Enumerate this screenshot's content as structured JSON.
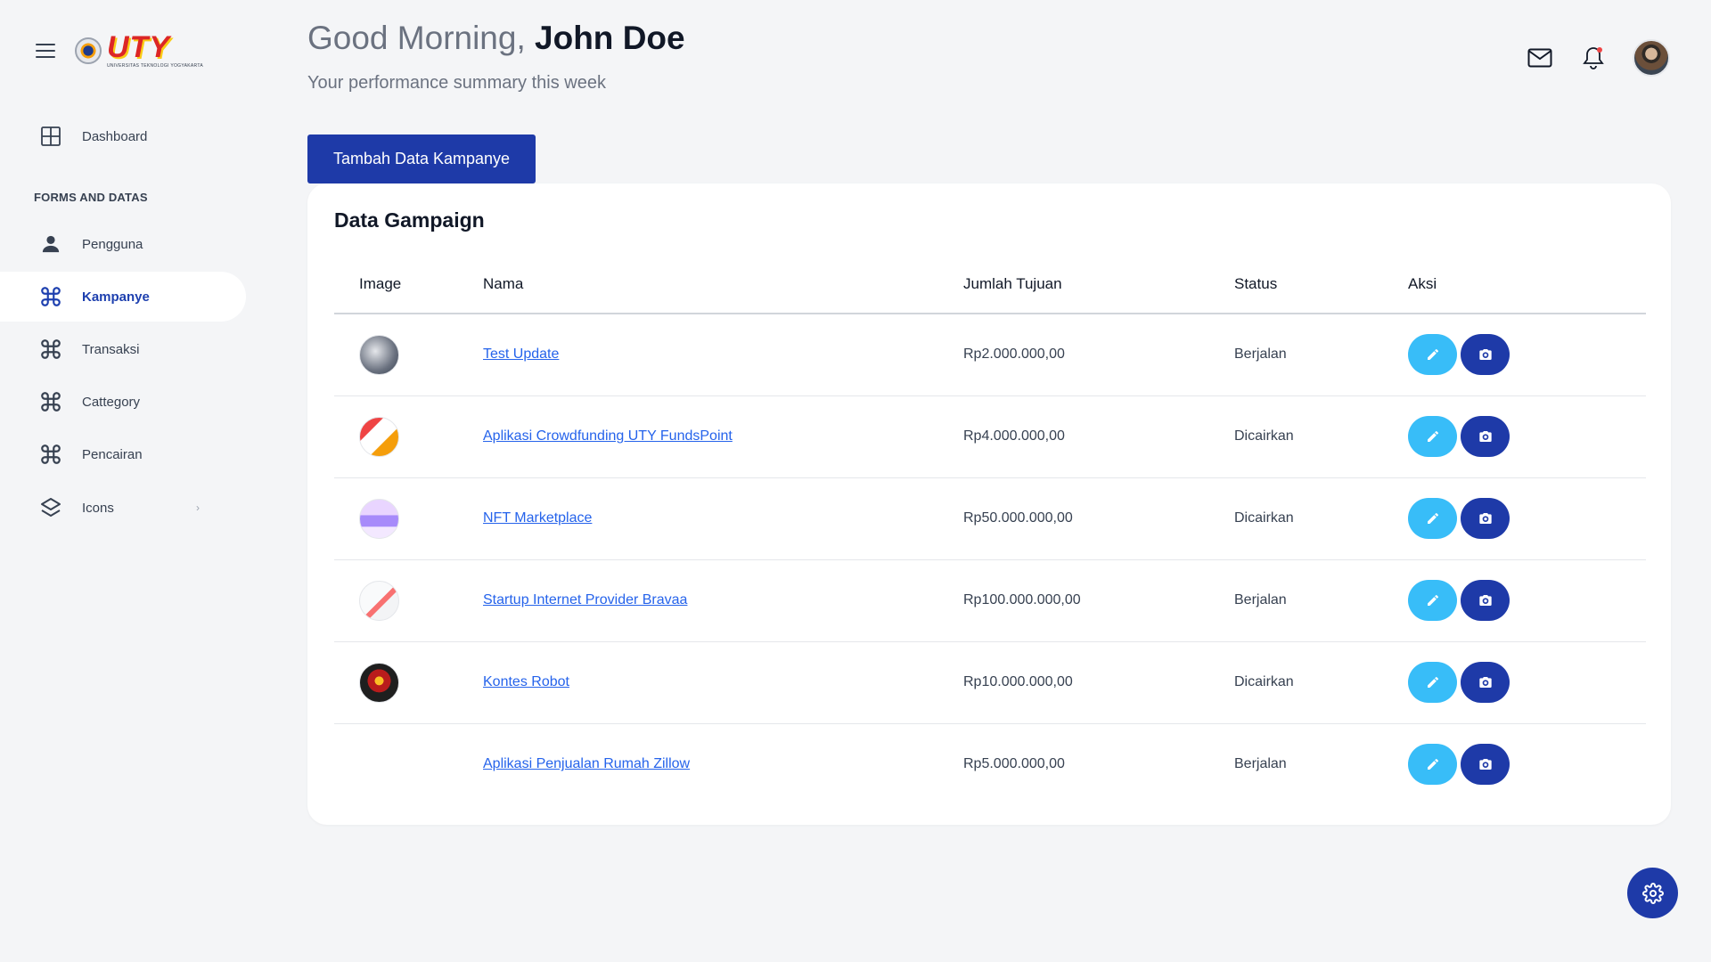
{
  "brand": {
    "logo_word": "UTY",
    "logo_sub": "UNIVERSITAS TEKNOLOGI YOGYAKARTA"
  },
  "sidebar": {
    "dashboard": "Dashboard",
    "section_label": "FORMS AND DATAS",
    "items": [
      {
        "label": "Pengguna",
        "icon": "user-icon"
      },
      {
        "label": "Kampanye",
        "icon": "command-icon",
        "active": true
      },
      {
        "label": "Transaksi",
        "icon": "command-icon"
      },
      {
        "label": "Cattegory",
        "icon": "command-icon"
      },
      {
        "label": "Pencairan",
        "icon": "command-icon"
      },
      {
        "label": "Icons",
        "icon": "layers-icon"
      }
    ]
  },
  "header": {
    "greeting": "Good Morning,",
    "user_name": "John Doe",
    "subtitle": "Your performance summary this week"
  },
  "add_button": "Tambah Data Kampanye",
  "card": {
    "title": "Data Gampaign",
    "columns": [
      "Image",
      "Nama",
      "Jumlah Tujuan",
      "Status",
      "Aksi"
    ],
    "rows": [
      {
        "nama": "Test Update",
        "jumlah": "Rp2.000.000,00",
        "status": "Berjalan"
      },
      {
        "nama": "Aplikasi Crowdfunding UTY FundsPoint",
        "jumlah": "Rp4.000.000,00",
        "status": "Dicairkan"
      },
      {
        "nama": "NFT Marketplace",
        "jumlah": "Rp50.000.000,00",
        "status": "Dicairkan"
      },
      {
        "nama": "Startup Internet Provider Bravaa",
        "jumlah": "Rp100.000.000,00",
        "status": "Berjalan"
      },
      {
        "nama": "Kontes Robot",
        "jumlah": "Rp10.000.000,00",
        "status": "Dicairkan"
      },
      {
        "nama": "Aplikasi Penjualan Rumah Zillow",
        "jumlah": "Rp5.000.000,00",
        "status": "Berjalan"
      }
    ]
  },
  "colors": {
    "primary": "#1e3aa8",
    "accent": "#38bdf8",
    "link": "#2563eb",
    "background": "#f4f5f7"
  }
}
